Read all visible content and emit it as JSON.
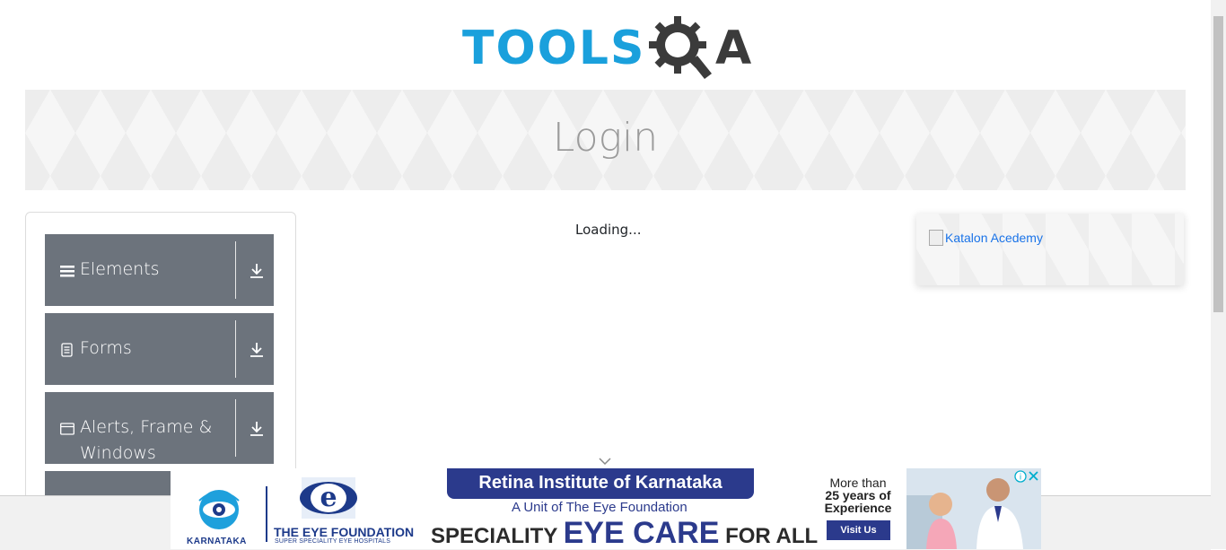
{
  "logo": {
    "text": "TOOLS",
    "suffix": "A"
  },
  "banner": {
    "title": "Login"
  },
  "sidebar": {
    "groups": [
      {
        "label": "Elements",
        "icon": "hamburger-icon"
      },
      {
        "label": "Forms",
        "icon": "document-icon"
      },
      {
        "label": "Alerts, Frame & Windows",
        "icon": "window-icon"
      }
    ]
  },
  "main": {
    "loading_text": "Loading..."
  },
  "right_ad": {
    "alt_text": "Katalon Acedemy"
  },
  "bottom_ad": {
    "brand": "RETINA INSTITUTE",
    "brand_region": "KARNATAKA",
    "foundation": "THE EYE FOUNDATION",
    "foundation_sub": "SUPER SPECIALITY EYE HOSPITALS",
    "headline": "Retina Institute of Karnataka",
    "unit": "A Unit of The Eye Foundation",
    "tagline_pre": "SPECIALITY",
    "tagline_big": "EYE CARE",
    "tagline_post": "FOR ALL",
    "experience_1": "More than",
    "experience_2": "25 years of",
    "experience_3": "Experience",
    "cta": "Visit Us"
  },
  "colors": {
    "brand_blue": "#1aa0dc",
    "sidebar_bg": "#6c737c",
    "ad_navy": "#2b3a8c"
  }
}
